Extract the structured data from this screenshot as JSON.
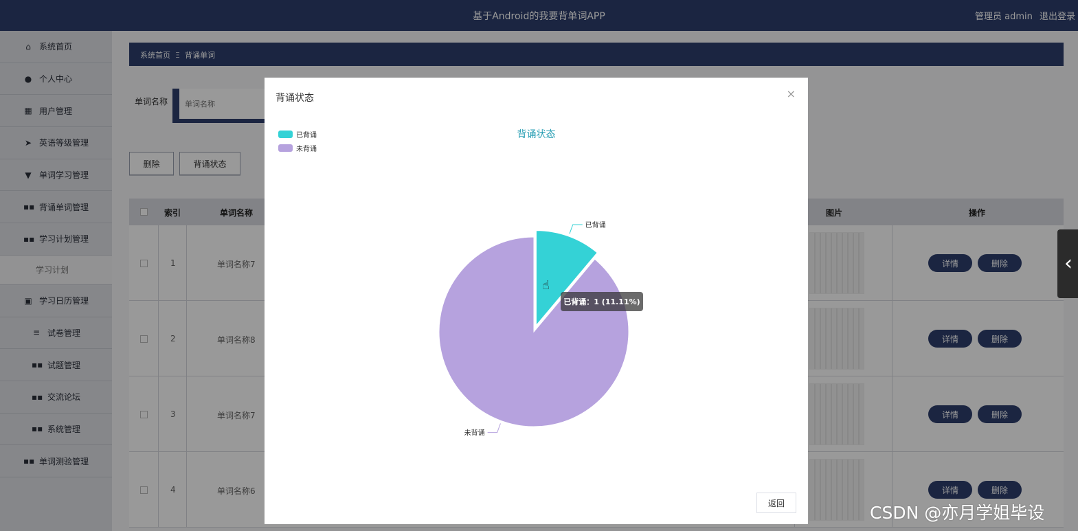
{
  "header": {
    "app_title": "基于Android的我要背单词APP",
    "user_role": "管理员 admin",
    "logout": "退出登录"
  },
  "sidebar": {
    "items": [
      {
        "label": "系统首页",
        "icon": "home-icon"
      },
      {
        "label": "个人中心",
        "icon": "user-icon"
      },
      {
        "label": "用户管理",
        "icon": "grid-icon"
      },
      {
        "label": "英语等级管理",
        "icon": "send-icon"
      },
      {
        "label": "单词学习管理",
        "icon": "flag-icon"
      },
      {
        "label": "背诵单词管理",
        "icon": "apps-icon"
      },
      {
        "label": "学习计划管理",
        "icon": "apps-icon"
      },
      {
        "label": "学习计划",
        "icon": ""
      },
      {
        "label": "学习日历管理",
        "icon": "calendar-icon"
      },
      {
        "label": "试卷管理",
        "icon": "sliders-icon"
      },
      {
        "label": "试题管理",
        "icon": "apps-icon"
      },
      {
        "label": "交流论坛",
        "icon": "apps-icon"
      },
      {
        "label": "系统管理",
        "icon": "apps-icon"
      },
      {
        "label": "单词测验管理",
        "icon": "apps-icon"
      }
    ]
  },
  "breadcrumb": {
    "home": "系统首页",
    "separator": "Ξ",
    "current": "背诵单词"
  },
  "search": {
    "label": "单词名称",
    "placeholder": "单词名称"
  },
  "toolbar": {
    "delete_label": "删除",
    "status_label": "背诵状态"
  },
  "table": {
    "headers": {
      "index": "索引",
      "word_name": "单词名称",
      "image": "图片",
      "actions": "操作"
    },
    "rows": [
      {
        "index": "1",
        "name": "单词名称7"
      },
      {
        "index": "2",
        "name": "单词名称8"
      },
      {
        "index": "3",
        "name": "单词名称7"
      },
      {
        "index": "4",
        "name": "单词名称6"
      }
    ],
    "detail_label": "详情",
    "delete_label": "删除"
  },
  "modal": {
    "title": "背诵状态",
    "close_symbol": "×",
    "return_label": "返回"
  },
  "chart_data": {
    "type": "pie",
    "title": "背诵状态",
    "legend_position": "top-left",
    "categories": [
      "已背诵",
      "未背诵"
    ],
    "values": [
      1,
      8
    ],
    "colors": [
      "#34d2d6",
      "#b6a2de"
    ],
    "tooltip": "已背诵：1 (11.11%)"
  },
  "watermark": "CSDN @亦月学姐毕设"
}
